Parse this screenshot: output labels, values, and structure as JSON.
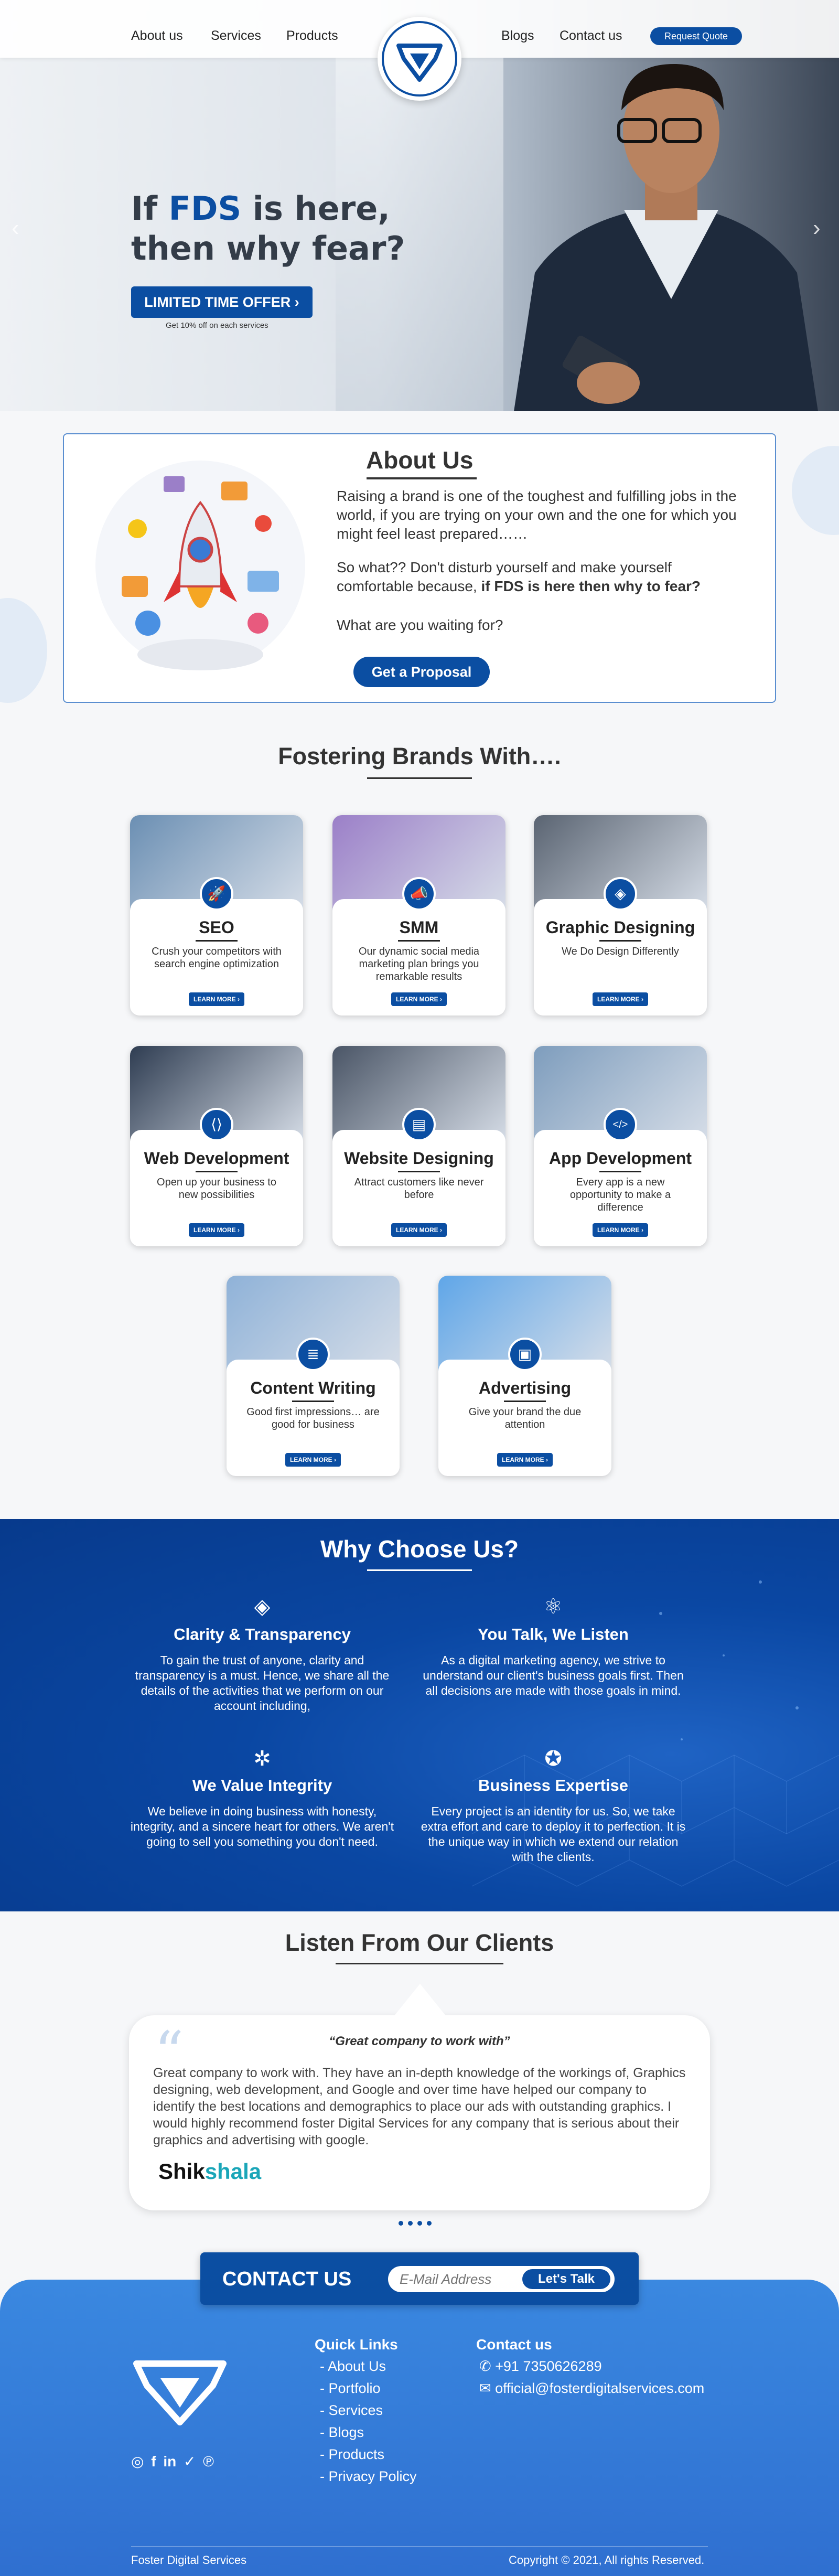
{
  "nav": {
    "items": [
      "About us",
      "Services",
      "Products",
      "Blogs",
      "Contact us"
    ],
    "request_quote": "Request Quote"
  },
  "hero": {
    "line1_prefix": "If ",
    "line1_brand": "FDS",
    "line1_suffix": " is here,",
    "line2": "then why fear?",
    "cta": "LIMITED TIME OFFER",
    "sub": "Get 10% off on each services",
    "prev": "‹",
    "next": "›"
  },
  "about": {
    "title": "About Us",
    "p1": "Raising a brand is one of the toughest and fulfilling jobs in the world, if you are trying on your own and the one for which you might feel least prepared……",
    "p2_a": "So what?? Don't disturb yourself and make yourself comfortable because, ",
    "p2_b": "if FDS is here then why to fear?",
    "p3": "What are you waiting for?",
    "button": "Get a Proposal"
  },
  "services": {
    "title": "Fostering Brands With….",
    "learn_more": "LEARN MORE ›",
    "items": [
      {
        "title": "SEO",
        "desc": "Crush your competitors with search engine optimization",
        "icon": "rocket-icon",
        "color": "#6b8fb3"
      },
      {
        "title": "SMM",
        "desc": "Our dynamic social media marketing plan brings you remarkable results",
        "icon": "megaphone-icon",
        "color": "#9b7fc8"
      },
      {
        "title": "Graphic Designing",
        "desc": "We Do Design Differently",
        "icon": "layers-icon",
        "color": "#5a6472"
      },
      {
        "title": "Web Development",
        "desc": "Open up your business to new possibilities",
        "icon": "code-window-icon",
        "color": "#2f3d52"
      },
      {
        "title": "Website Designing",
        "desc": "Attract customers like never before",
        "icon": "web-design-icon",
        "color": "#4a5566"
      },
      {
        "title": "App Development",
        "desc": "Every app is a new opportunity to make a difference",
        "icon": "code-icon",
        "color": "#7e9dbd"
      },
      {
        "title": "Content Writing",
        "desc": "Good first impressions… are good for business",
        "icon": "document-icon",
        "color": "#8fb2d8"
      },
      {
        "title": "Advertising",
        "desc": "Give your brand the due attention",
        "icon": "ad-icon",
        "color": "#5fa6e8"
      }
    ]
  },
  "why": {
    "title": "Why Choose Us?",
    "items": [
      {
        "title": "Clarity & Transparency",
        "desc": "To gain the trust of anyone, clarity and transparency is a must. Hence, we share all the details of the activities that we perform on our account including,",
        "icon": "diamond-icon",
        "glyph": "◈"
      },
      {
        "title": "You Talk, We Listen",
        "desc": "As a digital marketing agency, we strive to understand our client's business goals first. Then all decisions are made with those goals in mind.",
        "icon": "atom-icon",
        "glyph": "⚛"
      },
      {
        "title": "We Value Integrity",
        "desc": "We believe in doing business with honesty, integrity, and a sincere heart for others. We aren't going to sell you something you don't need.",
        "icon": "aperture-icon",
        "glyph": "✲"
      },
      {
        "title": "Business Expertise",
        "desc": "Every project is an identity for us. So, we take extra effort  and care to deploy it to perfection. It is the unique way in which we extend our relation with the clients.",
        "icon": "award-icon",
        "glyph": "✪"
      }
    ]
  },
  "testimonials": {
    "title": "Listen From Our Clients",
    "quote_title": "“Great company to work with”",
    "quote": "Great company to work with. They have an in-depth knowledge of the workings of, Graphics designing, web development, and Google and over time have helped our company to identify the best locations and demographics to place our ads with outstanding graphics. I would highly recommend foster Digital Services for any company that is serious about their graphics and advertising with google.",
    "brand_a": "Shik",
    "brand_b": "shala"
  },
  "contact": {
    "title": "CONTACT US",
    "placeholder": "E-Mail Address",
    "button": "Let's Talk"
  },
  "footer": {
    "quick_links_title": "Quick Links",
    "links": [
      "- About Us",
      "- Portfolio",
      "- Services",
      "- Blogs",
      "- Products",
      "- Privacy Policy"
    ],
    "contact_title": "Contact us",
    "phone": "+91 7350626289",
    "email": "official@fosterdigitalservices.com",
    "company": "Foster Digital Services",
    "copyright": "Copyright © 2021, All rights Reserved."
  }
}
